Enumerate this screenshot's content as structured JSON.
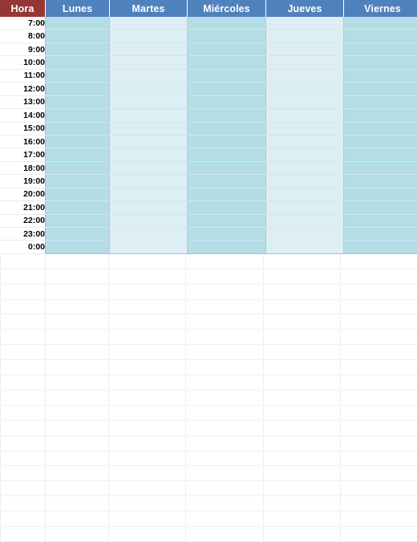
{
  "document": {
    "type": "weekly-schedule-table",
    "language": "es"
  },
  "colors": {
    "hora_header_bg": "#963634",
    "day_header_bg": "#4f81bd",
    "header_text": "#ffffff",
    "column_shade_dark": "#b4dde5",
    "column_shade_light": "#ddeff5",
    "hour_cell_bg": "#ffffff",
    "sheet_bg": "#ffffff",
    "gridline": "#f0f1f2"
  },
  "table": {
    "headers": [
      {
        "label": "Hora",
        "kind": "hour"
      },
      {
        "label": "Lunes",
        "kind": "day"
      },
      {
        "label": "Martes",
        "kind": "day"
      },
      {
        "label": "Miércoles",
        "kind": "day"
      },
      {
        "label": "Jueves",
        "kind": "day"
      },
      {
        "label": "Viernes",
        "kind": "day"
      }
    ],
    "hours": [
      "7:00",
      "8:00",
      "9:00",
      "10:00",
      "11:00",
      "12:00",
      "13:00",
      "14:00",
      "15:00",
      "16:00",
      "17:00",
      "18:00",
      "19:00",
      "20:00",
      "21:00",
      "22:00",
      "23:00",
      "0:00"
    ],
    "row_count": 18,
    "day_count": 5,
    "cells": [
      [
        "",
        "",
        "",
        "",
        ""
      ],
      [
        "",
        "",
        "",
        "",
        ""
      ],
      [
        "",
        "",
        "",
        "",
        ""
      ],
      [
        "",
        "",
        "",
        "",
        ""
      ],
      [
        "",
        "",
        "",
        "",
        ""
      ],
      [
        "",
        "",
        "",
        "",
        ""
      ],
      [
        "",
        "",
        "",
        "",
        ""
      ],
      [
        "",
        "",
        "",
        "",
        ""
      ],
      [
        "",
        "",
        "",
        "",
        ""
      ],
      [
        "",
        "",
        "",
        "",
        ""
      ],
      [
        "",
        "",
        "",
        "",
        ""
      ],
      [
        "",
        "",
        "",
        "",
        ""
      ],
      [
        "",
        "",
        "",
        "",
        ""
      ],
      [
        "",
        "",
        "",
        "",
        ""
      ],
      [
        "",
        "",
        "",
        "",
        ""
      ],
      [
        "",
        "",
        "",
        "",
        ""
      ],
      [
        "",
        "",
        "",
        "",
        ""
      ],
      [
        "",
        "",
        "",
        "",
        ""
      ]
    ]
  }
}
